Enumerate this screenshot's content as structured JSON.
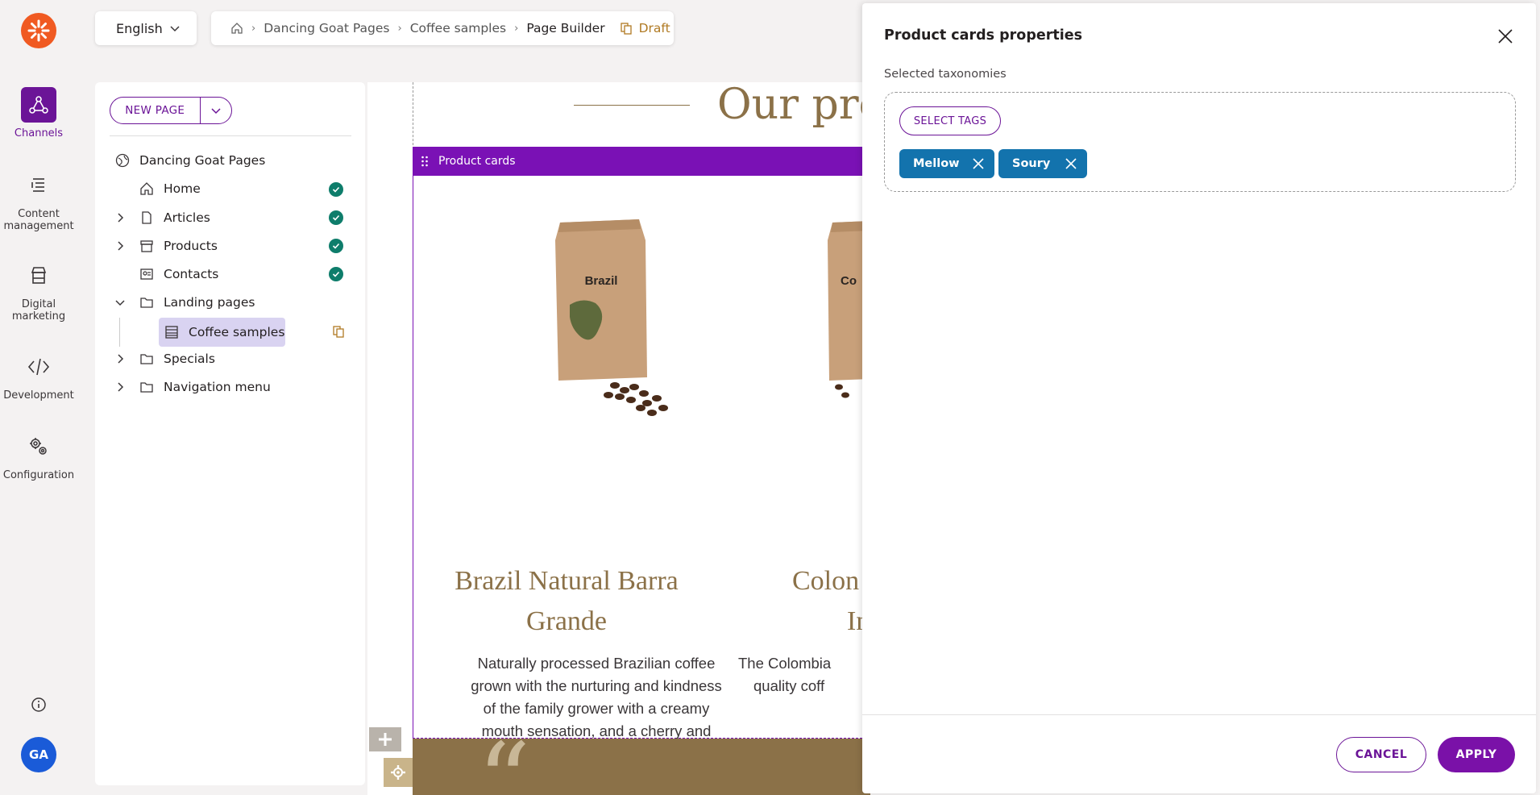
{
  "nav": {
    "items": [
      {
        "label": "Channels",
        "active": true
      },
      {
        "label": "Content management"
      },
      {
        "label": "Digital marketing"
      },
      {
        "label": "Development"
      },
      {
        "label": "Configuration"
      }
    ],
    "user_initials": "GA"
  },
  "header": {
    "language": "English",
    "breadcrumb": [
      "Dancing Goat Pages",
      "Coffee samples",
      "Page Builder"
    ],
    "status": "Draft"
  },
  "tree": {
    "new_page_label": "NEW PAGE",
    "nodes": [
      {
        "label": "Dancing Goat Pages"
      },
      {
        "label": "Home",
        "published": true
      },
      {
        "label": "Articles",
        "published": true
      },
      {
        "label": "Products",
        "published": true
      },
      {
        "label": "Contacts",
        "published": true
      },
      {
        "label": "Landing pages"
      },
      {
        "label": "Coffee samples",
        "selected": true
      },
      {
        "label": "Specials"
      },
      {
        "label": "Navigation menu"
      }
    ]
  },
  "canvas": {
    "heading": "Our previ",
    "widget_label": "Product cards",
    "cards": [
      {
        "bag_label": "Brazil",
        "title": "Brazil Natural Barra Grande",
        "description": "Naturally processed Brazilian coffee grown with the nurturing and kindness of the family grower with a creamy mouth sensation, and a cherry and chocolaty flavor."
      },
      {
        "bag_label": "Co",
        "title_line1": "Colon",
        "title_line2": "In",
        "desc_line1": "The Colombia",
        "desc_line2": "quality coff"
      }
    ],
    "quote_mark": "“"
  },
  "props": {
    "title": "Product cards properties",
    "field_label": "Selected taxonomies",
    "select_tags_label": "SELECT TAGS",
    "tags": [
      "Mellow",
      "Soury"
    ],
    "cancel_label": "CANCEL",
    "apply_label": "APPLY"
  },
  "colors": {
    "accent": "#6b1497",
    "widget_bar": "#7a11b5",
    "tag": "#1373ad",
    "published": "#0e7d6b",
    "brand_orange": "#f05a22",
    "coffee_brown": "#8b7148"
  }
}
